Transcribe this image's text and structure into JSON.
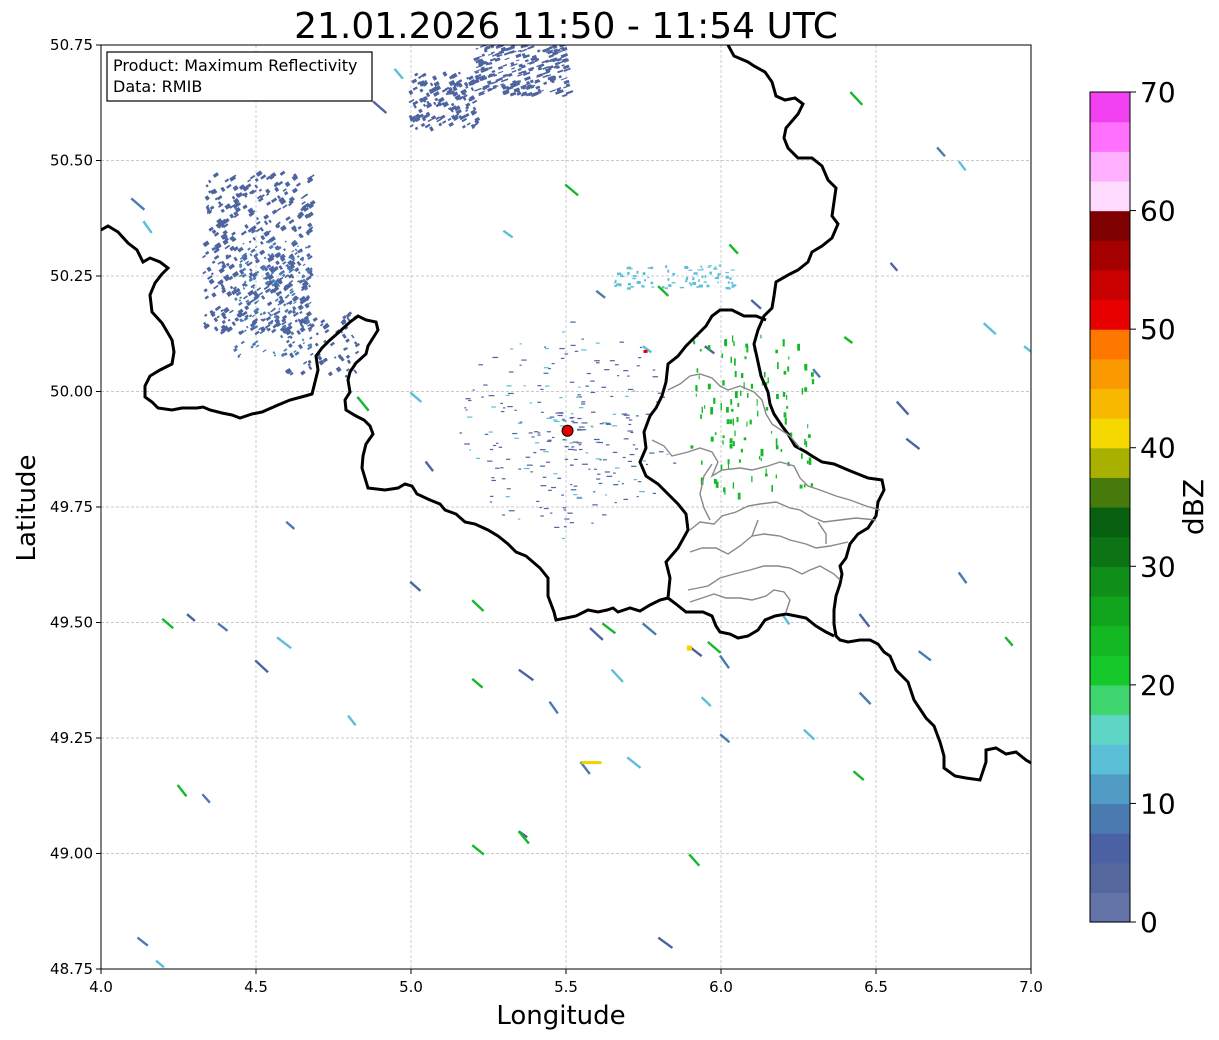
{
  "map": {
    "title": "21.01.2026 11:50 - 11:54 UTC",
    "info_box": {
      "line1": "Product: Maximum Reflectivity",
      "line2": "Data: RMIB"
    },
    "x_axis": {
      "label": "Longitude",
      "range": [
        4.0,
        7.0
      ],
      "ticks": [
        "4.0",
        "4.5",
        "5.0",
        "5.5",
        "6.0",
        "6.5",
        "7.0"
      ]
    },
    "y_axis": {
      "label": "Latitude",
      "range": [
        48.75,
        50.75
      ],
      "ticks": [
        "48.75",
        "49.00",
        "49.25",
        "49.50",
        "49.75",
        "50.00",
        "50.25",
        "50.50",
        "50.75"
      ]
    },
    "grid": true,
    "radar_site": {
      "lon": 5.505,
      "lat": 49.915
    },
    "colorbar": {
      "label": "dBZ",
      "range": [
        0,
        70
      ],
      "step": 2.5,
      "ticks": [
        "0",
        "10",
        "20",
        "30",
        "40",
        "50",
        "60",
        "70"
      ],
      "colors": [
        "#6574a8",
        "#55689e",
        "#4a61a3",
        "#4a7bb0",
        "#509cc4",
        "#5cbfd8",
        "#5ed6c6",
        "#3fd66f",
        "#15c92b",
        "#13b823",
        "#11a51d",
        "#0f8f1a",
        "#0d7416",
        "#075f10",
        "#477a0c",
        "#a8b000",
        "#f5d800",
        "#f8b800",
        "#fb9900",
        "#fe7800",
        "#e60000",
        "#c80000",
        "#a50000",
        "#7f0000",
        "#ffdcff",
        "#ffb0ff",
        "#ff70ff",
        "#f040f0"
      ]
    },
    "echo_colors": {
      "weak": "#4e64a0",
      "light": "#4a7bb0",
      "cyan": "#5cbfd8",
      "green": "#15b82a",
      "yellow": "#f2d200",
      "red": "#e00000"
    }
  }
}
